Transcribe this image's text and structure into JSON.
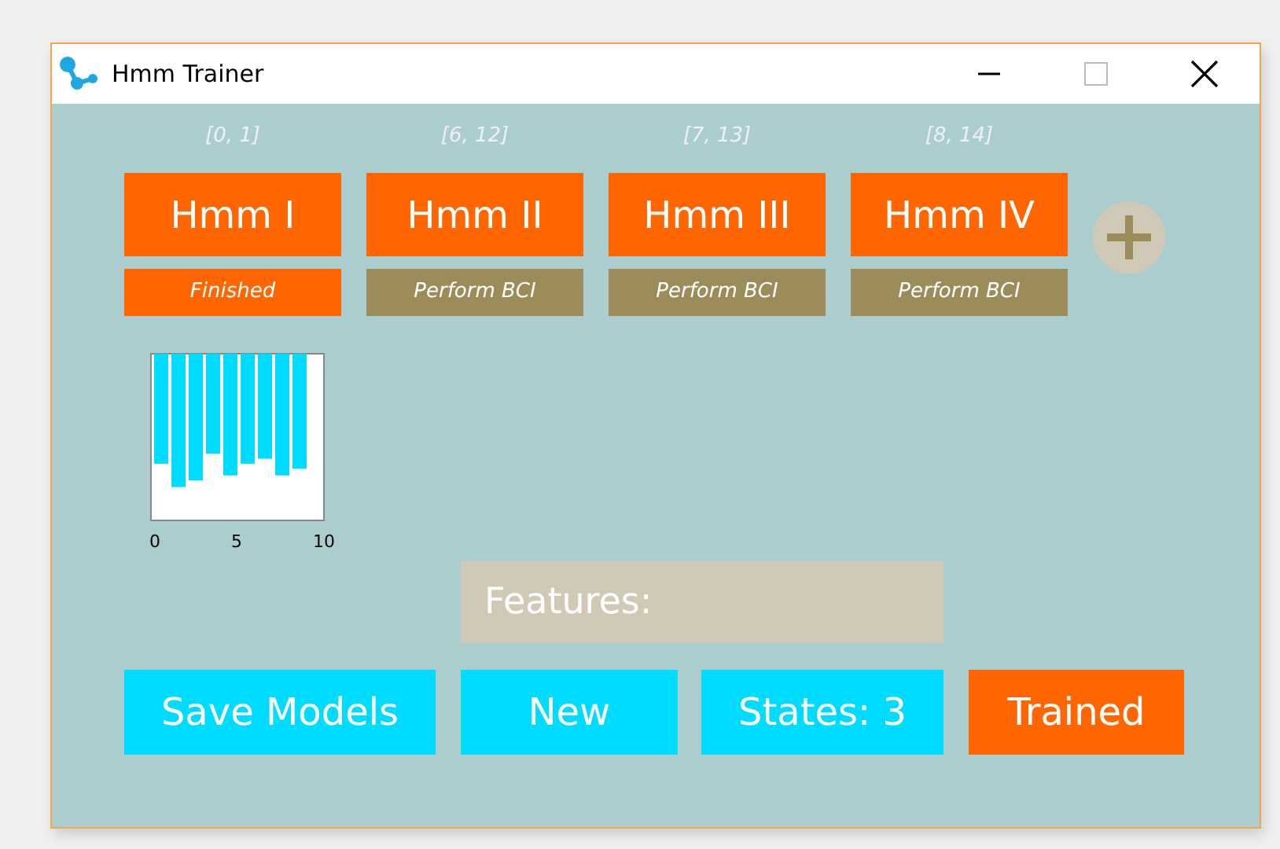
{
  "window": {
    "title": "Hmm Trainer"
  },
  "models": [
    {
      "range": "[0, 1]",
      "name": "Hmm I",
      "status": "Finished",
      "done": true
    },
    {
      "range": "[6, 12]",
      "name": "Hmm II",
      "status": "Perform BCI",
      "done": false
    },
    {
      "range": "[7, 13]",
      "name": "Hmm III",
      "status": "Perform BCI",
      "done": false
    },
    {
      "range": "[8, 14]",
      "name": "Hmm IV",
      "status": "Perform BCI",
      "done": false
    }
  ],
  "chart": {
    "x_tick_labels": [
      "0",
      "5",
      "10"
    ]
  },
  "features": {
    "label": "Features:"
  },
  "buttons": [
    {
      "label": "Save Models",
      "active": false
    },
    {
      "label": "New",
      "active": false
    },
    {
      "label": "States: 3",
      "active": false
    },
    {
      "label": "Trained",
      "active": true
    }
  ]
}
